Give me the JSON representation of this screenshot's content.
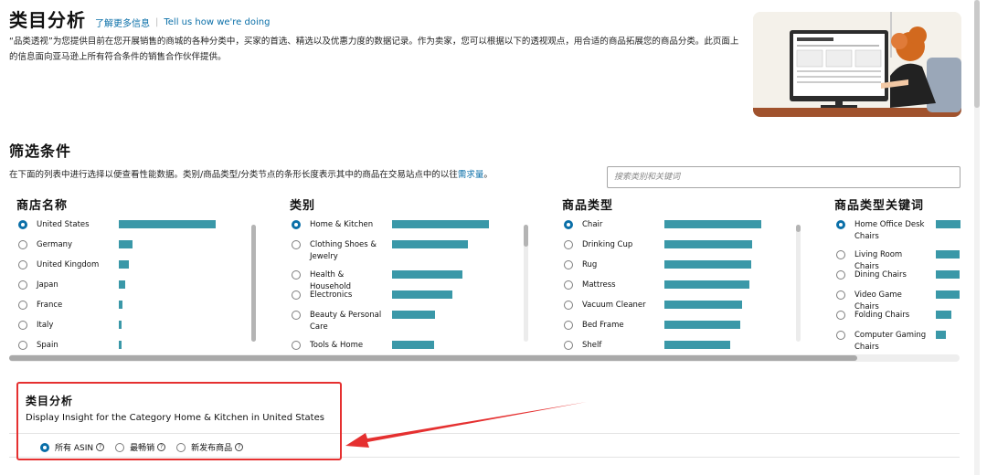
{
  "header": {
    "title": "类目分析",
    "learn_more": "了解更多信息",
    "feedback": "Tell us how we're doing"
  },
  "intro_text": "“品类透视”为您提供目前在您开展销售的商城的各种分类中，买家的首选、精选以及优惠力度的数据记录。作为卖家，您可以根据以下的透视观点，用合适的商品拓展您的商品分类。此页面上的信息面向亚马逊上所有符合条件的销售合作伙伴提供。",
  "filters": {
    "title": "筛选条件",
    "description": "在下面的列表中进行选择以便查看性能数据。类别/商品类型/分类节点的条形长度表示其中的商品在交易站点中的以往",
    "description_highlight": "需求量",
    "description_end": "。",
    "search_placeholder": "搜索类别和关键词"
  },
  "columns": {
    "stores": {
      "header": "商店名称",
      "items": [
        {
          "label": "United States",
          "selected": true,
          "demand": 1.0
        },
        {
          "label": "Germany",
          "selected": false,
          "demand": 0.14
        },
        {
          "label": "United Kingdom",
          "selected": false,
          "demand": 0.1
        },
        {
          "label": "Japan",
          "selected": false,
          "demand": 0.07
        },
        {
          "label": "France",
          "selected": false,
          "demand": 0.04
        },
        {
          "label": "Italy",
          "selected": false,
          "demand": 0.03
        },
        {
          "label": "Spain",
          "selected": false,
          "demand": 0.02
        }
      ]
    },
    "categories": {
      "header": "类别",
      "items": [
        {
          "label": "Home & Kitchen",
          "selected": true,
          "demand": 1.0
        },
        {
          "label": "Clothing Shoes & Jewelry",
          "selected": false,
          "demand": 0.78
        },
        {
          "label": "Health & Household",
          "selected": false,
          "demand": 0.73
        },
        {
          "label": "Electronics",
          "selected": false,
          "demand": 0.62
        },
        {
          "label": "Beauty & Personal Care",
          "selected": false,
          "demand": 0.44
        },
        {
          "label": "Tools & Home",
          "selected": false,
          "demand": 0.43
        }
      ]
    },
    "product_types": {
      "header": "商品类型",
      "items": [
        {
          "label": "Chair",
          "selected": true,
          "demand": 1.0
        },
        {
          "label": "Drinking Cup",
          "selected": false,
          "demand": 0.91
        },
        {
          "label": "Rug",
          "selected": false,
          "demand": 0.9
        },
        {
          "label": "Mattress",
          "selected": false,
          "demand": 0.88
        },
        {
          "label": "Vacuum Cleaner",
          "selected": false,
          "demand": 0.8
        },
        {
          "label": "Bed Frame",
          "selected": false,
          "demand": 0.78
        },
        {
          "label": "Shelf",
          "selected": false,
          "demand": 0.68
        }
      ]
    },
    "keywords": {
      "header": "商品类型关键词",
      "items": [
        {
          "label": "Home Office Desk Chairs",
          "selected": true,
          "demand": 1.0
        },
        {
          "label": "Living Room Chairs",
          "selected": false,
          "demand": 0.96
        },
        {
          "label": "Dining Chairs",
          "selected": false,
          "demand": 0.96
        },
        {
          "label": "Video Game Chairs",
          "selected": false,
          "demand": 0.96
        },
        {
          "label": "Folding Chairs",
          "selected": false,
          "demand": 0.62
        },
        {
          "label": "Computer Gaming Chairs",
          "selected": false,
          "demand": 0.4
        }
      ]
    }
  },
  "insight": {
    "title": "类目分析",
    "subtitle": "Display Insight for the Category Home & Kitchen in United States",
    "options": [
      {
        "label": "所有 ASIN",
        "selected": true
      },
      {
        "label": "最畅销",
        "selected": false
      },
      {
        "label": "新发布商品",
        "selected": false
      }
    ]
  },
  "colors": {
    "accent": "#0a6fa8",
    "bar": "#3a98a8",
    "highlight_border": "#e53030"
  }
}
